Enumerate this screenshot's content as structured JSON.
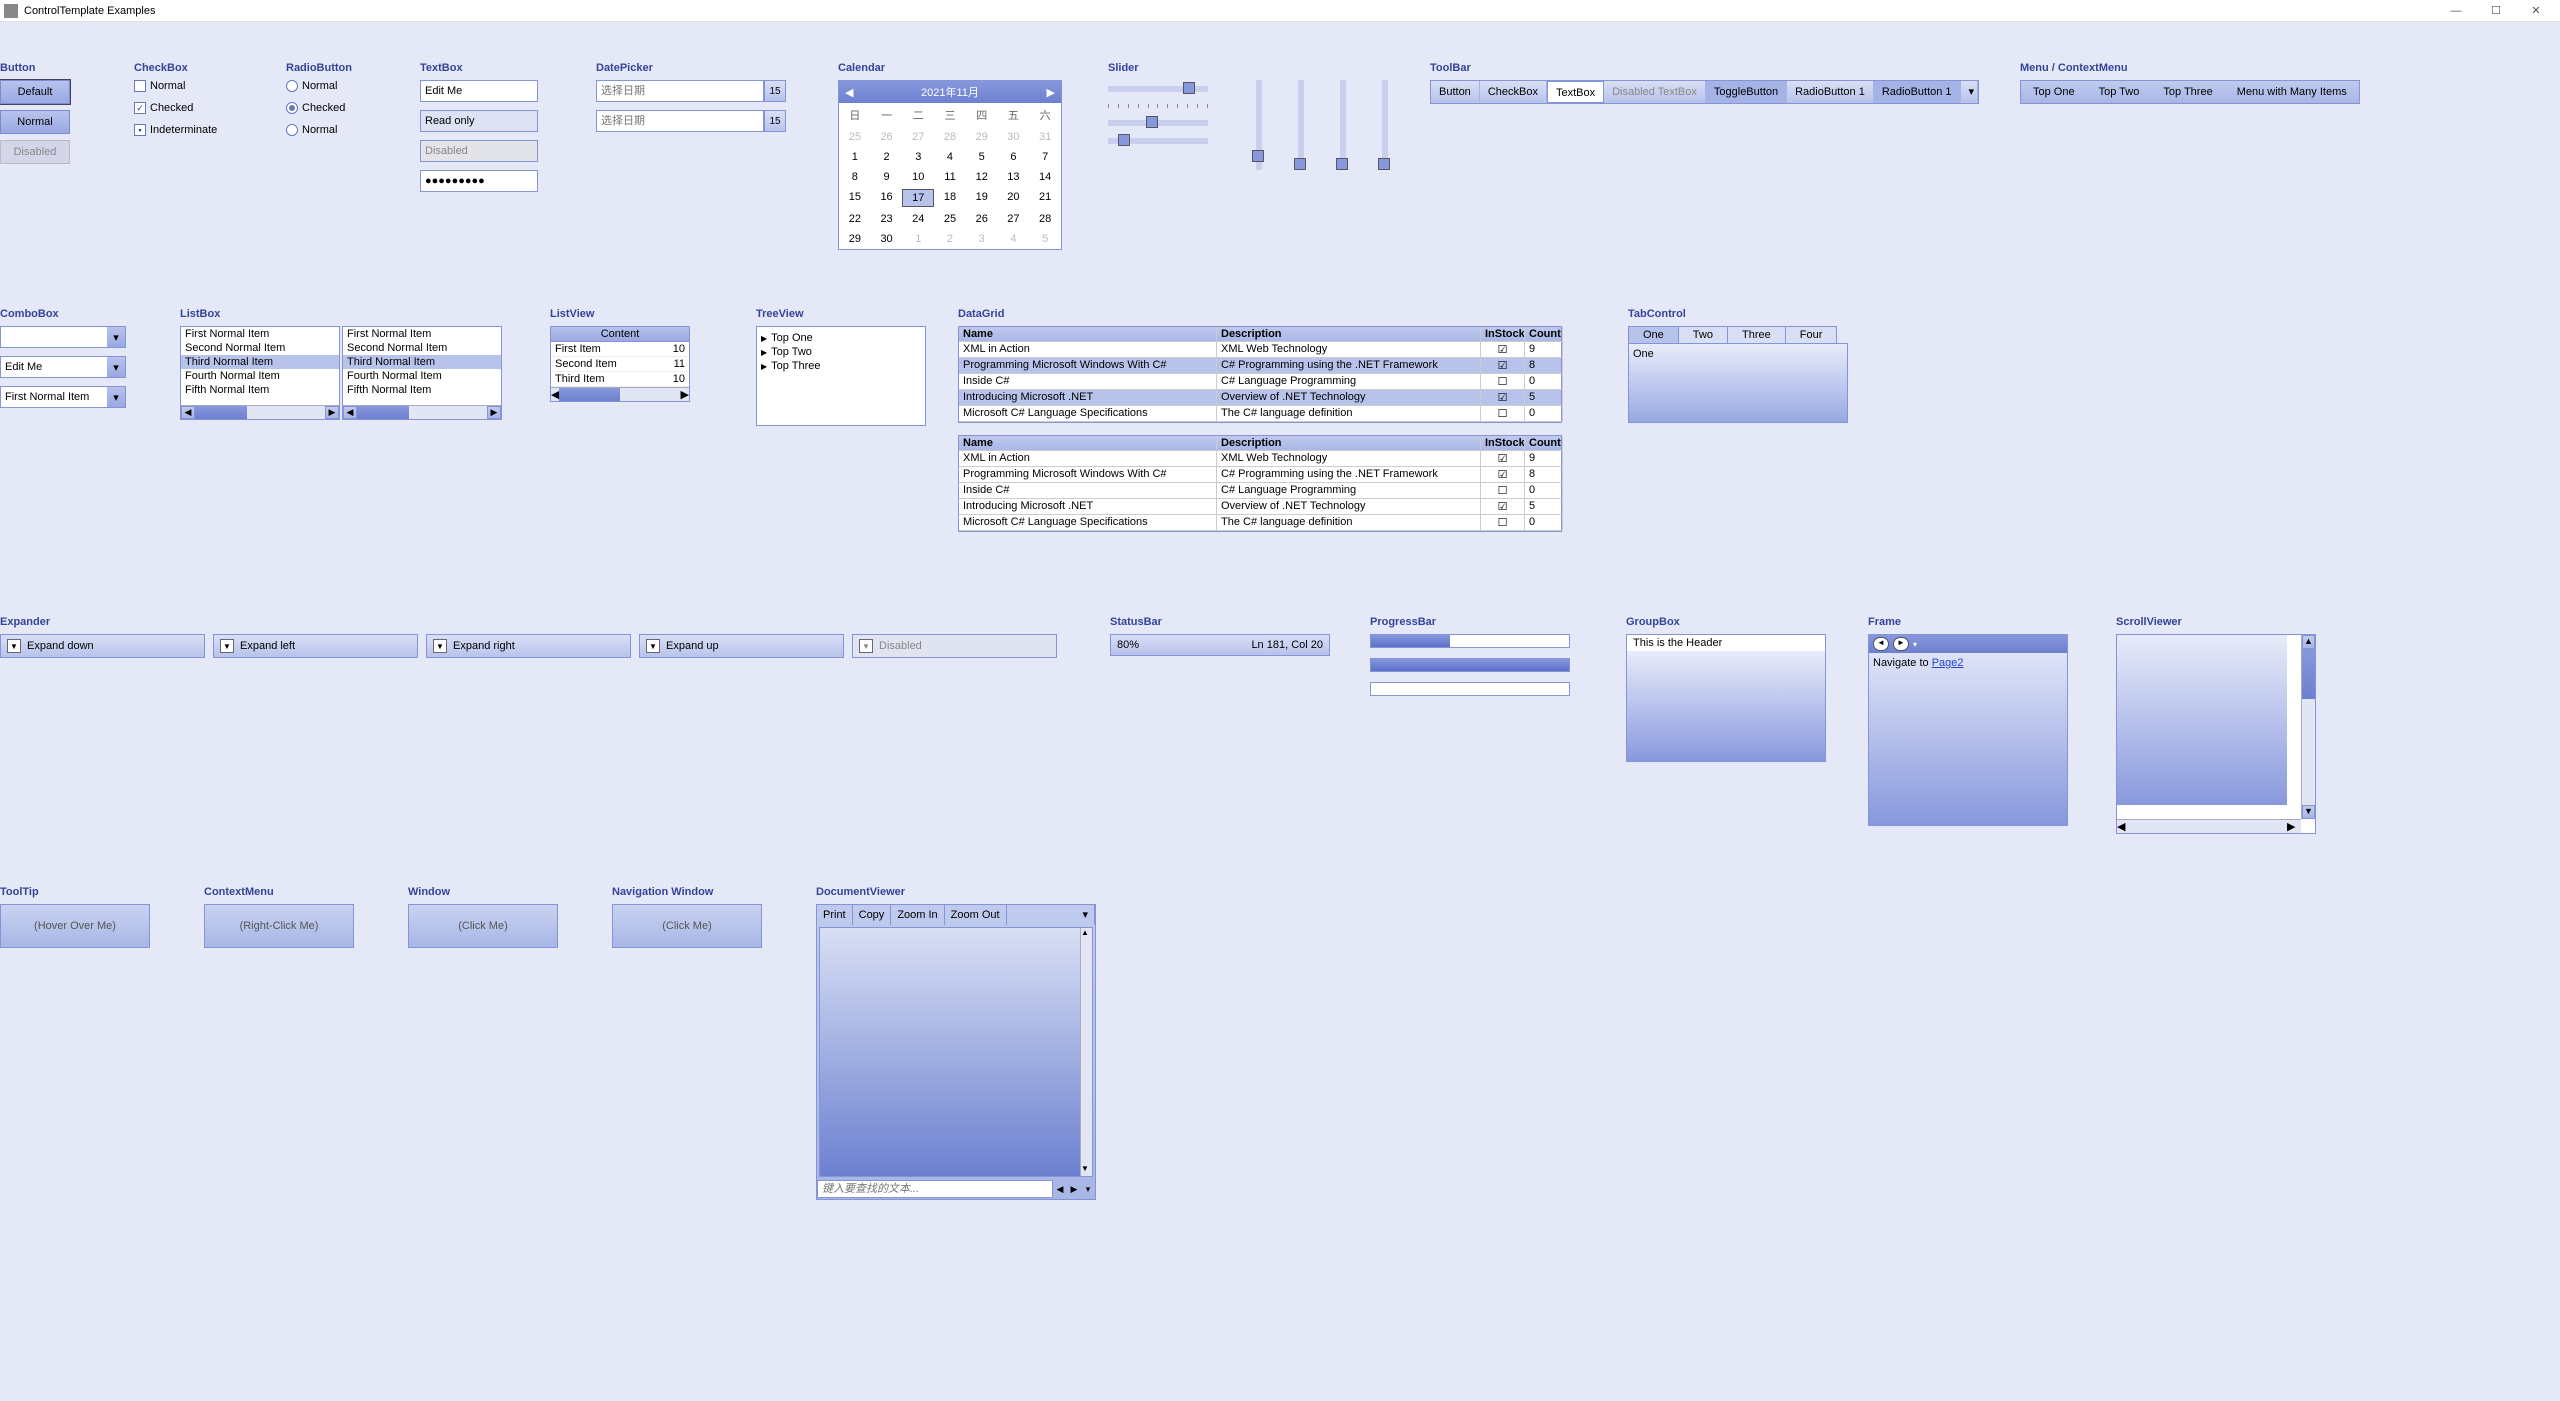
{
  "window": {
    "title": "ControlTemplate Examples"
  },
  "buttons": {
    "title": "Button",
    "default": "Default",
    "normal": "Normal",
    "disabled": "Disabled"
  },
  "checkbox": {
    "title": "CheckBox",
    "normal": "Normal",
    "checked": "Checked",
    "indeterminate": "Indeterminate"
  },
  "radio": {
    "title": "RadioButton",
    "normal": "Normal",
    "checked": "Checked",
    "normal2": "Normal"
  },
  "textbox": {
    "title": "TextBox",
    "edit": "Edit Me",
    "readonly": "Read only",
    "disabled": "Disabled",
    "password": "●●●●●●●●●"
  },
  "datepicker": {
    "title": "DatePicker",
    "placeholder": "选择日期",
    "btn": "15"
  },
  "calendar": {
    "title": "Calendar",
    "month": "2021年11月",
    "dow": [
      "日",
      "一",
      "二",
      "三",
      "四",
      "五",
      "六"
    ],
    "weeks": [
      [
        25,
        26,
        27,
        28,
        29,
        30,
        31
      ],
      [
        1,
        2,
        3,
        4,
        5,
        6,
        7
      ],
      [
        8,
        9,
        10,
        11,
        12,
        13,
        14
      ],
      [
        15,
        16,
        17,
        18,
        19,
        20,
        21
      ],
      [
        22,
        23,
        24,
        25,
        26,
        27,
        28
      ],
      [
        29,
        30,
        1,
        2,
        3,
        4,
        5
      ]
    ],
    "today": 17
  },
  "slider": {
    "title": "Slider"
  },
  "toolbar": {
    "title": "ToolBar",
    "items": [
      "Button",
      "CheckBox",
      "TextBox",
      "Disabled TextBox",
      "ToggleButton",
      "RadioButton 1",
      "RadioButton 1"
    ]
  },
  "menu": {
    "title": "Menu / ContextMenu",
    "items": [
      "Top One",
      "Top Two",
      "Top Three",
      "Menu with Many Items"
    ]
  },
  "combobox": {
    "title": "ComboBox",
    "edit": "Edit Me",
    "first": "First Normal Item"
  },
  "listbox": {
    "title": "ListBox",
    "items": [
      "First Normal Item",
      "Second Normal Item",
      "Third Normal Item",
      "Fourth Normal Item",
      "Fifth Normal Item"
    ],
    "selected": 2
  },
  "listview": {
    "title": "ListView",
    "header": "Content",
    "rows": [
      [
        "First Item",
        "10"
      ],
      [
        "Second Item",
        "11"
      ],
      [
        "Third Item",
        "10"
      ]
    ]
  },
  "treeview": {
    "title": "TreeView",
    "items": [
      "Top One",
      "Top Two",
      "Top Three"
    ]
  },
  "datagrid": {
    "title": "DataGrid",
    "cols": [
      "Name",
      "Description",
      "InStock",
      "Count"
    ],
    "rows": [
      {
        "name": "XML in Action",
        "desc": "XML Web Technology",
        "stock": true,
        "count": 9
      },
      {
        "name": "Programming Microsoft Windows With C#",
        "desc": "C# Programming using the .NET Framework",
        "stock": true,
        "count": 8
      },
      {
        "name": "Inside C#",
        "desc": "C# Language Programming",
        "stock": false,
        "count": 0
      },
      {
        "name": "Introducing Microsoft .NET",
        "desc": "Overview of .NET Technology",
        "stock": true,
        "count": 5
      },
      {
        "name": "Microsoft C# Language Specifications",
        "desc": "The C# language definition",
        "stock": false,
        "count": 0
      }
    ],
    "selected": [
      1,
      3
    ]
  },
  "tab": {
    "title": "TabControl",
    "tabs": [
      "One",
      "Two",
      "Three",
      "Four"
    ],
    "active": 0,
    "body": "One"
  },
  "expander": {
    "title": "Expander",
    "down": "Expand down",
    "left": "Expand left",
    "right": "Expand right",
    "up": "Expand up",
    "disabled": "Disabled"
  },
  "statusbar": {
    "title": "StatusBar",
    "left": "80%",
    "right": "Ln 181, Col 20"
  },
  "progress": {
    "title": "ProgressBar"
  },
  "groupbox": {
    "title": "GroupBox",
    "header": "This is the Header"
  },
  "frame": {
    "title": "Frame",
    "nav_text": "Navigate to ",
    "link": "Page2"
  },
  "scrollviewer": {
    "title": "ScrollViewer"
  },
  "tooltip": {
    "title": "ToolTip",
    "label": "(Hover Over Me)"
  },
  "contextmenu": {
    "title": "ContextMenu",
    "label": "(Right-Click Me)"
  },
  "windowctrl": {
    "title": "Window",
    "label": "(Click Me)"
  },
  "navwin": {
    "title": "Navigation Window",
    "label": "(Click Me)"
  },
  "docviewer": {
    "title": "DocumentViewer",
    "tools": [
      "Print",
      "Copy",
      "Zoom In",
      "Zoom Out"
    ],
    "find_placeholder": "键入要查找的文本..."
  }
}
